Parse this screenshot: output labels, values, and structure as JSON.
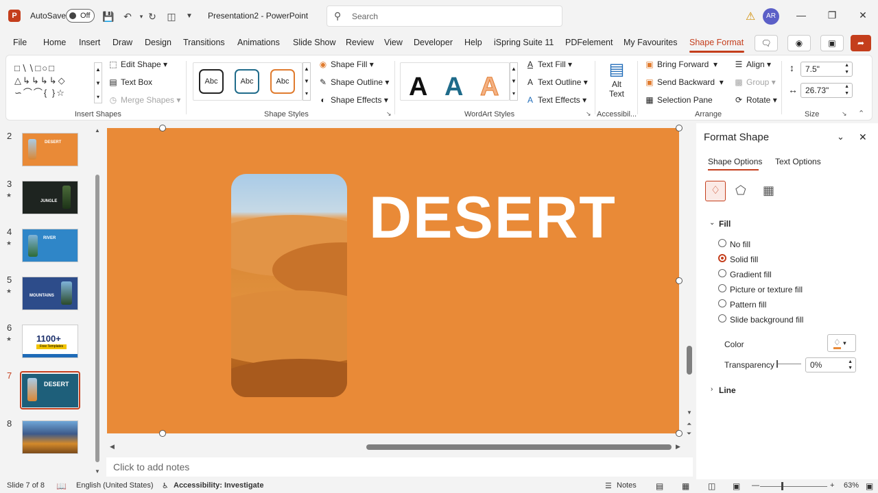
{
  "titlebar": {
    "autosave_label": "AutoSave",
    "autosave_state": "Off",
    "doc_title": "Presentation2  -  PowerPoint",
    "search_placeholder": "Search",
    "avatar_initials": "AR"
  },
  "menu": {
    "tabs": [
      "File",
      "Home",
      "Insert",
      "Draw",
      "Design",
      "Transitions",
      "Animations",
      "Slide Show",
      "Review",
      "View",
      "Developer",
      "Help",
      "iSpring Suite 11",
      "PDFelement",
      "My Favourites",
      "Shape Format"
    ],
    "active_tab": "Shape Format"
  },
  "ribbon": {
    "insert_shapes": {
      "label": "Insert Shapes",
      "edit_shape": "Edit Shape",
      "text_box": "Text Box",
      "merge_shapes": "Merge Shapes"
    },
    "shape_styles": {
      "label": "Shape Styles",
      "sample": "Abc",
      "shape_fill": "Shape Fill",
      "shape_outline": "Shape Outline",
      "shape_effects": "Shape Effects"
    },
    "wordart": {
      "label": "WordArt Styles",
      "sample": "A",
      "text_fill": "Text Fill",
      "text_outline": "Text Outline",
      "text_effects": "Text Effects"
    },
    "accessibility": {
      "label": "Accessibil...",
      "alt_text_1": "Alt",
      "alt_text_2": "Text"
    },
    "arrange": {
      "label": "Arrange",
      "bring_forward": "Bring Forward",
      "send_backward": "Send Backward",
      "selection_pane": "Selection Pane",
      "align": "Align",
      "group": "Group",
      "rotate": "Rotate"
    },
    "size": {
      "label": "Size",
      "height": "7.5\"",
      "width": "26.73\""
    }
  },
  "thumbnails": [
    {
      "num": "2",
      "star": false,
      "title": "DESERT"
    },
    {
      "num": "3",
      "star": true,
      "title": "JUNGLE"
    },
    {
      "num": "4",
      "star": true,
      "title": "RIVER"
    },
    {
      "num": "5",
      "star": true,
      "title": "MOUNTAINS"
    },
    {
      "num": "6",
      "star": true,
      "title": "1100+"
    },
    {
      "num": "7",
      "star": false,
      "title": "DESERT"
    },
    {
      "num": "8",
      "star": false,
      "title": ""
    }
  ],
  "thumb6_sub": "Free Templates",
  "slide": {
    "title": "DESERT"
  },
  "notes_placeholder": "Click to add notes",
  "format_pane": {
    "title": "Format Shape",
    "tab_shape": "Shape Options",
    "tab_text": "Text Options",
    "fill_section": "Fill",
    "fill_options": [
      "No fill",
      "Solid fill",
      "Gradient fill",
      "Picture or texture fill",
      "Pattern fill",
      "Slide background fill"
    ],
    "selected_fill": "Solid fill",
    "color_label": "Color",
    "transparency_label": "Transparency",
    "transparency_value": "0%",
    "line_section": "Line"
  },
  "status": {
    "slide_info": "Slide 7 of 8",
    "language": "English (United States)",
    "accessibility": "Accessibility: Investigate",
    "notes": "Notes",
    "zoom": "63%"
  },
  "colors": {
    "accent": "#c43e1c",
    "slide_bg": "#e98a37"
  }
}
